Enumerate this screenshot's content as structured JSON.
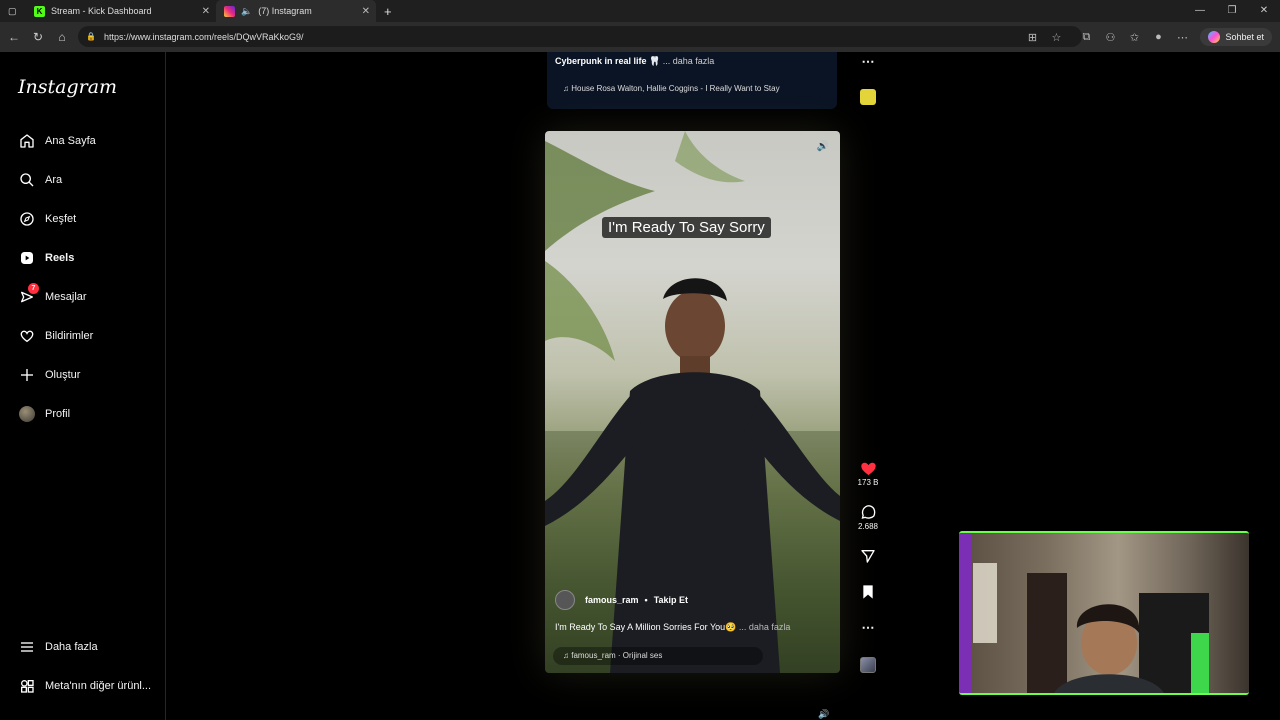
{
  "browser": {
    "tabs": [
      {
        "label": "Stream - Kick Dashboard",
        "icon": "kick-icon"
      },
      {
        "label": "(7) Instagram",
        "icon": "instagram-icon"
      }
    ],
    "url": "https://www.instagram.com/reels/DQwVRaKkoG9/",
    "chat_label": "Sohbet et"
  },
  "sidebar": {
    "logo": "Instagram",
    "items": [
      {
        "label": "Ana Sayfa",
        "icon": "home-icon"
      },
      {
        "label": "Ara",
        "icon": "search-icon"
      },
      {
        "label": "Keşfet",
        "icon": "compass-icon"
      },
      {
        "label": "Reels",
        "icon": "reels-icon"
      },
      {
        "label": "Mesajlar",
        "icon": "messenger-icon"
      },
      {
        "label": "Bildirimler",
        "icon": "heart-icon"
      },
      {
        "label": "Oluştur",
        "icon": "plus-icon"
      },
      {
        "label": "Profil",
        "icon": "avatar"
      }
    ],
    "messages_badge": "7",
    "bottom_items": [
      {
        "label": "Daha fazla",
        "icon": "menu-icon"
      },
      {
        "label": "Meta'nın diğer ürünl...",
        "icon": "meta-apps-icon"
      }
    ]
  },
  "previous_reel": {
    "caption": "Cyberpunk in real life 🦷",
    "more": "... daha fazla",
    "music": "♫ House  Rosa Walton, Hallie Coggins - I Really Want to Stay"
  },
  "reel": {
    "overlay_text": "I'm Ready To Say Sorry",
    "username": "famous_ram",
    "follow_label": "Takip Et",
    "caption": "I'm Ready To Say A Million Sorries For You🥺",
    "more": "... daha fazla",
    "music": "♫ famous_ram · Orijinal ses",
    "likes": "173 B",
    "comments": "2.688"
  },
  "colors": {
    "like": "#ff3040",
    "webcam_border": "#6cff4a"
  }
}
